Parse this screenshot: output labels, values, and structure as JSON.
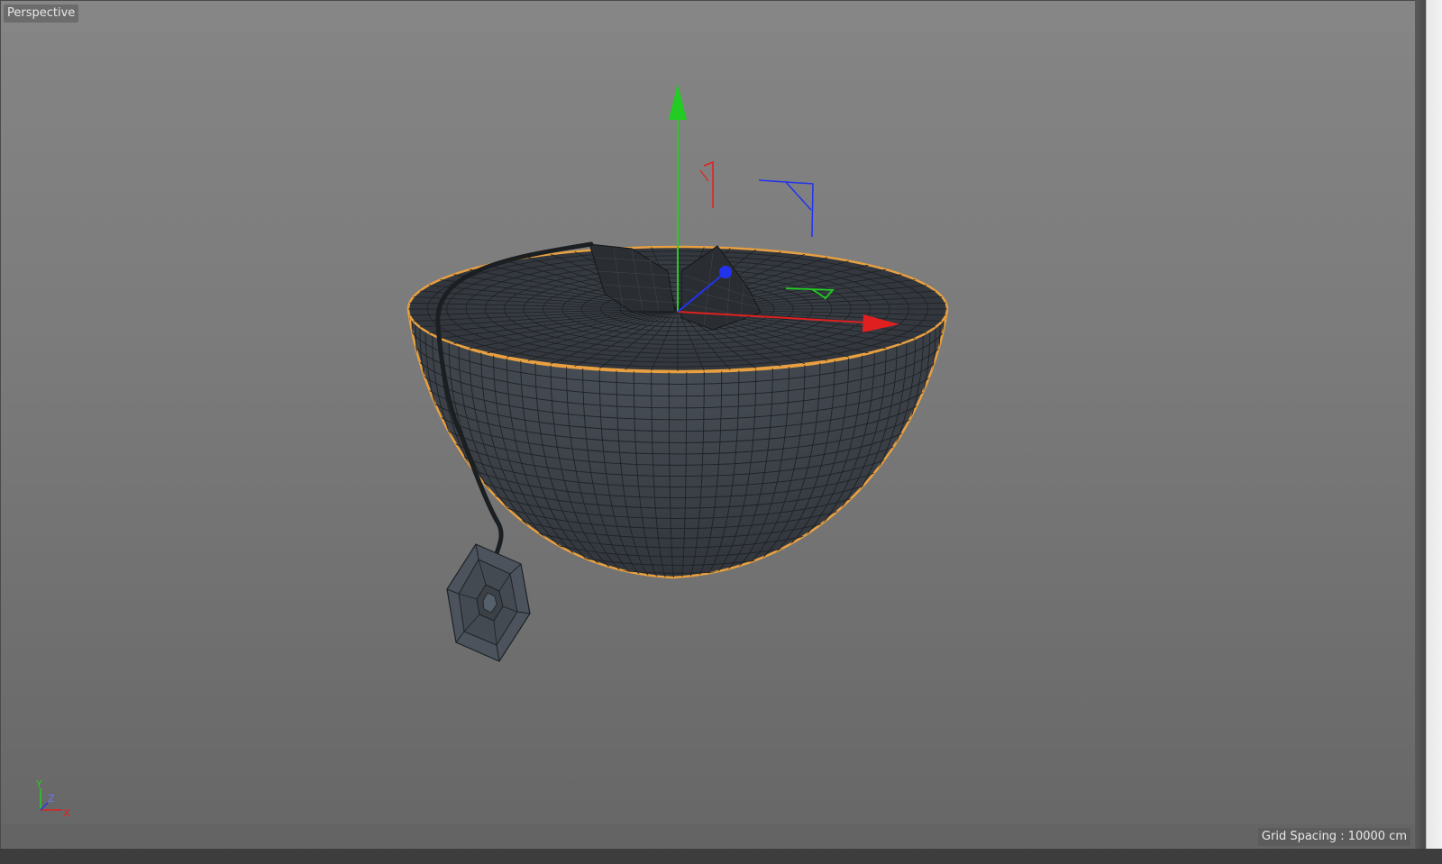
{
  "viewport": {
    "view_name": "Perspective",
    "grid_spacing": "Grid Spacing : 10000 cm"
  },
  "axis_indicator": {
    "y": "Y",
    "z": "Z",
    "x": "X"
  },
  "colors": {
    "x_axis": "#e02020",
    "y_axis": "#22cc22",
    "z_axis": "#2233ee",
    "selection_outline": "#e8a040",
    "mesh": "#3b4048",
    "wire": "#1e2226"
  },
  "icons": {
    "move_gizmo": "move-gizmo-icon",
    "axis_indicator": "axis-indicator-icon"
  }
}
